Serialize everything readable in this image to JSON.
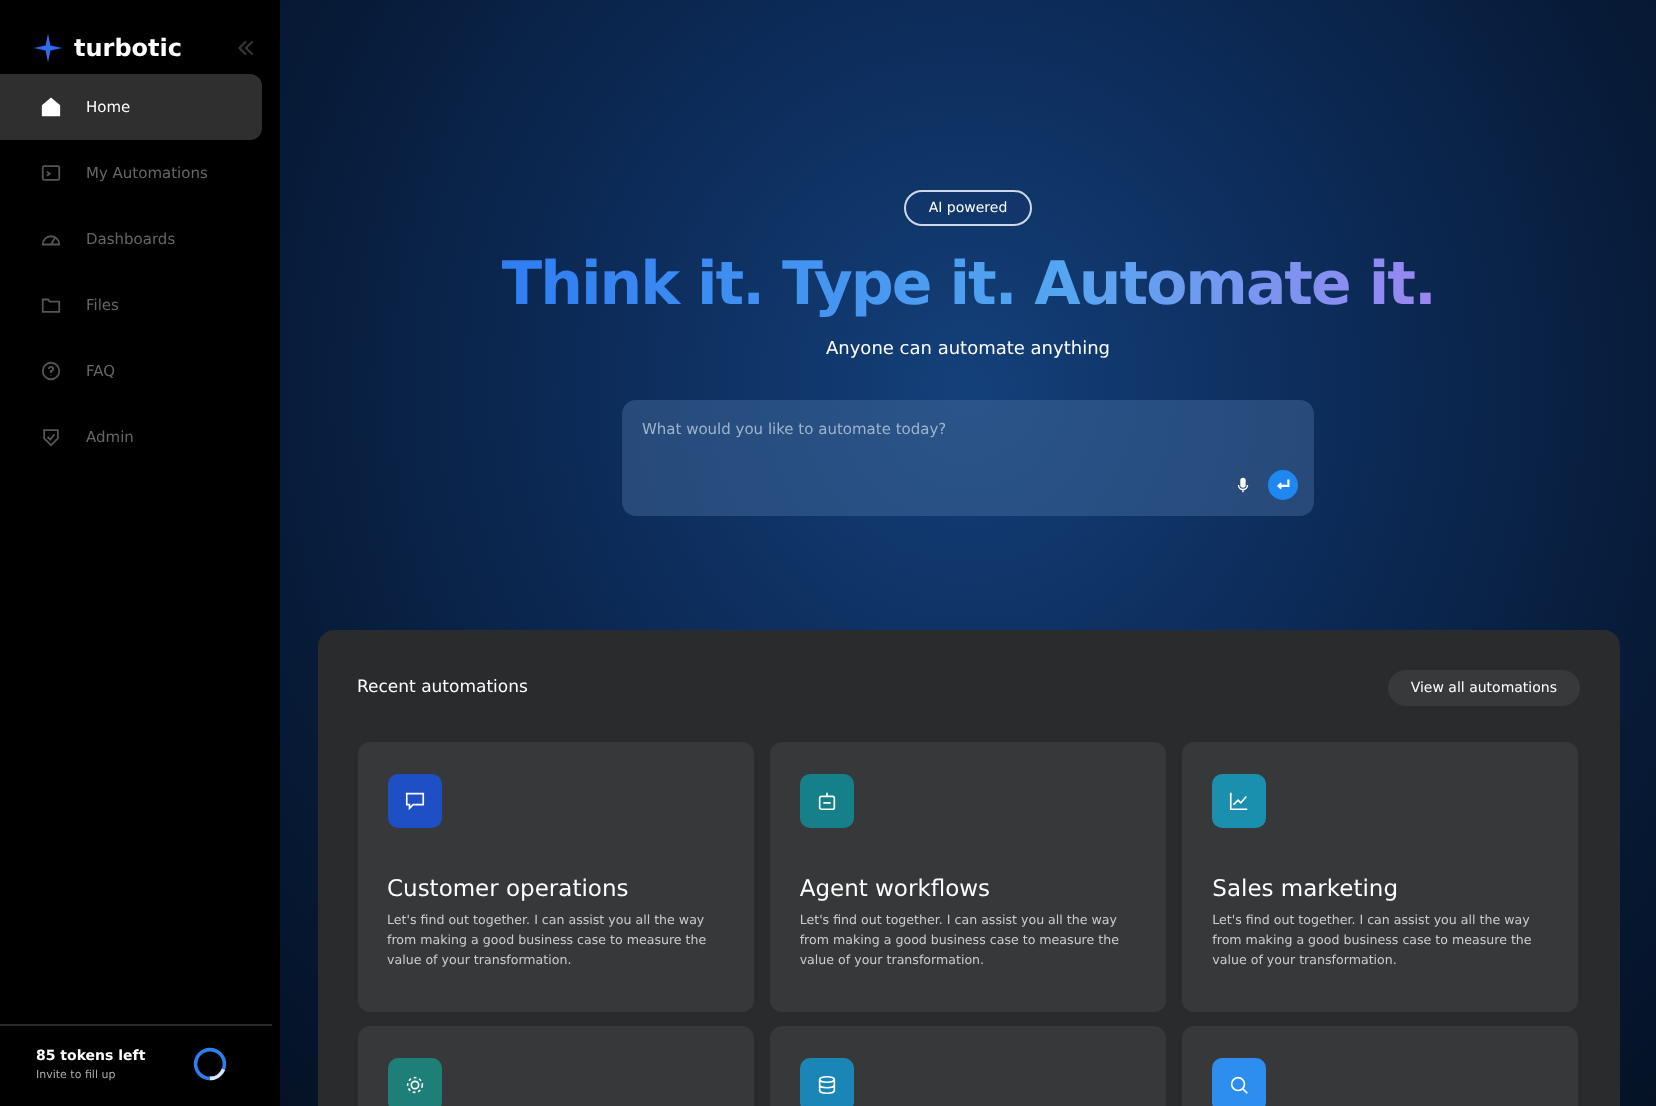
{
  "sidebar": {
    "brand": "turbotic",
    "items": [
      {
        "label": "Home",
        "selected": true
      },
      {
        "label": "My Automations",
        "selected": false
      },
      {
        "label": "Dashboards",
        "selected": false
      },
      {
        "label": "Files",
        "selected": false
      },
      {
        "label": "FAQ",
        "selected": false
      },
      {
        "label": "Admin",
        "selected": false
      }
    ],
    "tokens": {
      "count": "85 tokens left",
      "hint": "Invite to fill up"
    }
  },
  "hero": {
    "badge": "AI powered",
    "title": "Think it. Type it. Automate it.",
    "subtitle": "Anyone can automate anything",
    "prompt": {
      "placeholder": "What would you like to automate today?"
    }
  },
  "recent": {
    "title": "Recent automations",
    "view_all": "View all automations",
    "cards": [
      {
        "color": "#1f4fc4",
        "title": "Customer operations",
        "text": "Let's find out together. I can assist you all the way from making a good business case to measure the value of your transformation."
      },
      {
        "color": "#157f8a",
        "title": "Agent workflows",
        "text": "Let's find out together. I can assist you all the way from making a good business case to measure the value of your transformation."
      },
      {
        "color": "#1a8fae",
        "title": "Sales marketing",
        "text": "Let's find out together. I can assist you all the way from making a good business case to measure the value of your transformation."
      },
      {
        "color": "#1d7f78"
      },
      {
        "color": "#1a86b8"
      },
      {
        "color": "#2e8ef0"
      }
    ]
  }
}
